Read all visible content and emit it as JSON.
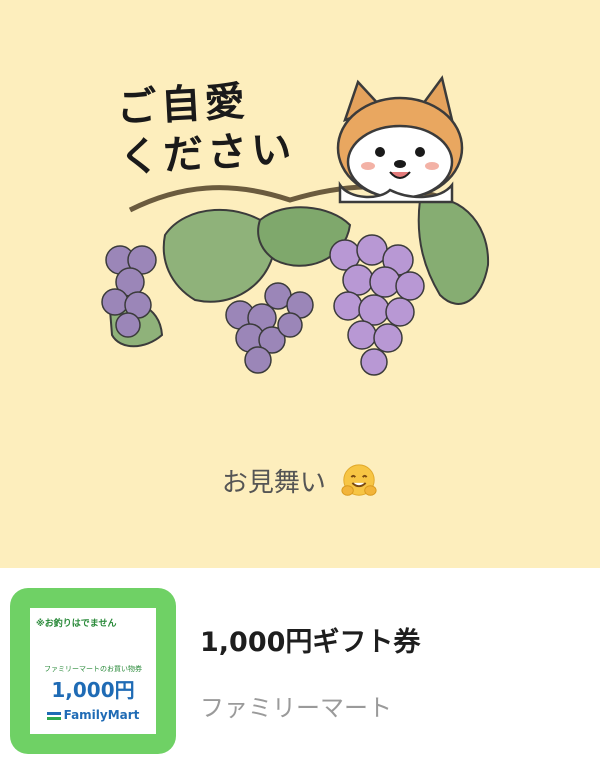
{
  "message": {
    "headline_line1": "ご自愛",
    "headline_line2": "ください",
    "caption": "お見舞い",
    "caption_emoji": "hugging-face-emoji",
    "background_color": "#fdeebd"
  },
  "gift": {
    "title": "1,000円ギフト券",
    "brand": "ファミリーマート",
    "thumbnail": {
      "note": "※お釣りはでません",
      "subtitle": "ファミリーマートのお買い物券",
      "amount": "1,000円",
      "brand": "FamilyMart",
      "frame_color": "#6fd165"
    }
  }
}
